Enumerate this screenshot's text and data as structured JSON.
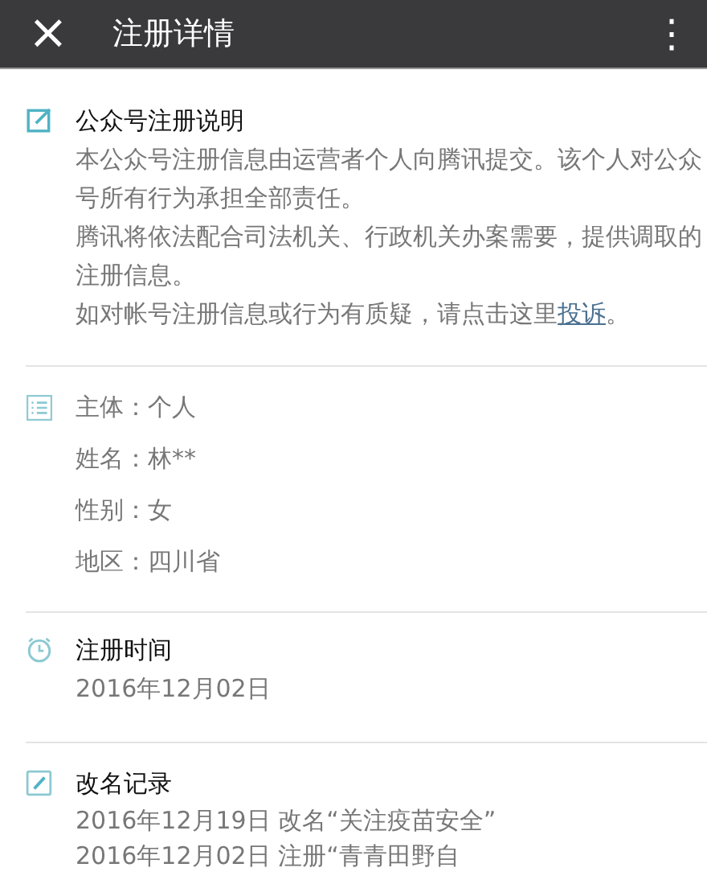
{
  "app_bar": {
    "close": "×",
    "title": "注册详情",
    "menu": "⋮"
  },
  "sections": [
    {
      "kind": "notice",
      "title": "公众号注册说明",
      "paragraphs": [
        {
          "text": "本公众号注册信息由运营者个人向腾讯提交。该个人对公众号所有行为承担全部责任。"
        },
        {
          "text": "腾讯将依法配合司法机关、行政机关办案需要，提供调取的注册信息。"
        },
        {
          "text": "如对帐号注册信息或行为有质疑，请点击这里",
          "link": "投诉",
          "after": "。"
        }
      ]
    },
    {
      "kind": "info",
      "rows": [
        "主体：个人",
        "姓名：林**",
        "性别：女",
        "地区：四川省"
      ]
    },
    {
      "kind": "time",
      "title": "注册时间",
      "rows": [
        "2016年12月02日"
      ]
    },
    {
      "kind": "history",
      "title": "改名记录",
      "rows": [
        "2016年12月19日 改名“关注疫苗安全”",
        "2016年12月02日 注册“青青田野自"
      ]
    }
  ]
}
